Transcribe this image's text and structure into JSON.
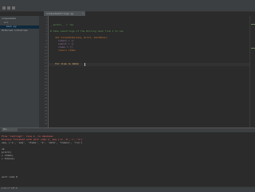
{
  "editor": {
    "tab_label": "uniqueSubstrings.py",
    "close_glyph": "×",
    "line_numbers": [
      "1",
      "2",
      "3",
      "4",
      "5",
      "6",
      "7",
      "8",
      "9",
      "10",
      "11",
      "12",
      "13",
      "14",
      "15",
      "16",
      "17",
      "18",
      "19",
      "20",
      "21",
      "22",
      "23",
      "24",
      "25",
      "26",
      "27",
      "28",
      "29",
      "30",
      "31",
      "32",
      "33",
      "34",
      "35"
    ],
    "code_lines": [
      {
        "text": "__author__ = 'me'",
        "cls": "cm"
      },
      {
        "text": "# take substrings of the Rolling hash from 1 to len",
        "cls": "cm"
      },
      {
        "text": "def uniqueSubs(seq, min=1, max=None):",
        "cls": "kw"
      },
      {
        "text": "    tokens = []",
        "cls": ""
      },
      {
        "text": "    subcnt = []",
        "cls": ""
      },
      {
        "text": "    items = []",
        "cls": ""
      },
      {
        "text": "    return items",
        "cls": "kw"
      },
      {
        "text": "for line in data:",
        "cls": "fn"
      }
    ]
  },
  "project": {
    "rows": [
      "uniqueSubs",
      "src",
      "main.py",
      "External Libraries"
    ]
  },
  "run": {
    "tab_label": "Run",
    "lines": [
      {
        "text": "  File \"<string>\", line 1, in <module>",
        "cls": "err"
      },
      {
        "text": "  Process finished with exit code 1; seq ['a','b','c','d']",
        "cls": "err"
      },
      {
        "text": "seq, ['a', 'seq', 'items', 'b', 'data', 'tokens', 'run']",
        "cls": ""
      },
      {
        "text": "ok",
        "cls": ""
      },
      {
        "text": "print()",
        "cls": ""
      },
      {
        "text": "+ items)",
        "cls": ""
      },
      {
        "text": "+ tokens)",
        "cls": ""
      },
      {
        "text": "",
        "cls": ""
      },
      {
        "text": "exit code 0",
        "cls": ""
      }
    ]
  },
  "status": {
    "text": "4:21  LF  UTF-8"
  }
}
